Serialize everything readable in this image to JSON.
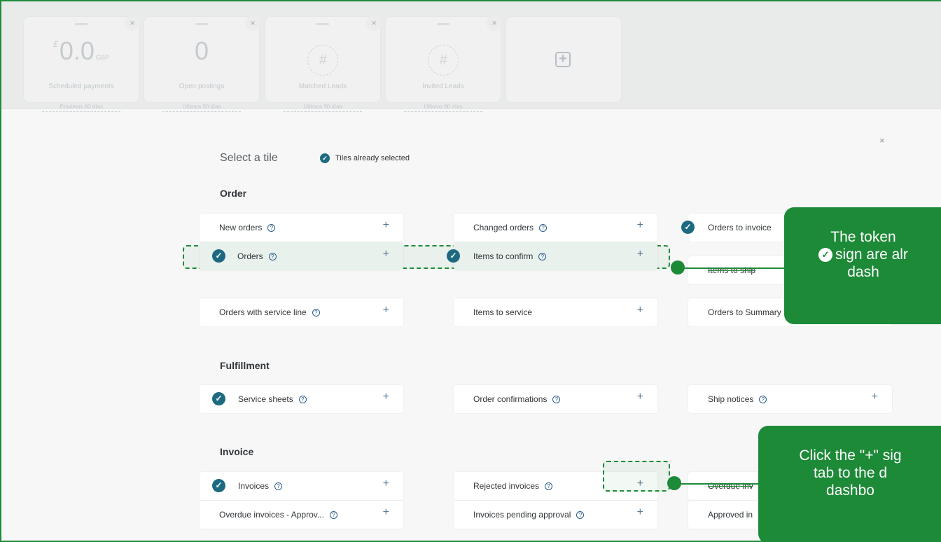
{
  "kpis": [
    {
      "currency": "£",
      "value": "0.0",
      "unit": "GBP",
      "label": "Scheduled payments",
      "period": "Próximos 90 días"
    },
    {
      "value": "0",
      "label": "Open postings",
      "period": "Últimos 90 días"
    },
    {
      "icon": "#",
      "label": "Matched Leads",
      "period": "Últimos 90 días"
    },
    {
      "icon": "#",
      "label": "Invited Leads",
      "period": "Últimos 90 días"
    }
  ],
  "kpi_close": "×",
  "add_tile_icon": "+",
  "dialog": {
    "close": "×",
    "title": "Select a tile",
    "legend": "Tiles already selected"
  },
  "check_glyph": "✓",
  "help_glyph": "?",
  "plus_glyph": "+",
  "sections": {
    "order": {
      "title": "Order",
      "tiles": [
        {
          "name": "New orders",
          "help": true,
          "selected": false
        },
        {
          "name": "Changed orders",
          "help": true,
          "selected": false
        },
        {
          "name": "Orders to invoice",
          "help": false,
          "selected": true
        },
        {
          "name": "Orders",
          "help": true,
          "selected": true
        },
        {
          "name": "Items to confirm",
          "help": true,
          "selected": true
        },
        {
          "name": "Items to ship",
          "help": false,
          "selected": true
        },
        {
          "name": "Orders with service line",
          "help": true,
          "selected": false
        },
        {
          "name": "Items to service",
          "help": false,
          "selected": false
        },
        {
          "name": "Orders to Summary",
          "help": false,
          "selected": false
        }
      ]
    },
    "fulfillment": {
      "title": "Fulfillment",
      "tiles": [
        {
          "name": "Service sheets",
          "help": true,
          "selected": true
        },
        {
          "name": "Order confirmations",
          "help": true,
          "selected": false
        },
        {
          "name": "Ship notices",
          "help": true,
          "selected": false
        }
      ]
    },
    "invoice": {
      "title": "Invoice",
      "tiles": [
        {
          "name": "Invoices",
          "help": true,
          "selected": true
        },
        {
          "name": "Rejected invoices",
          "help": true,
          "selected": false
        },
        {
          "name": "Overdue inv",
          "help": false,
          "selected": false
        },
        {
          "name": "Overdue invoices - Approv...",
          "help": true,
          "selected": false
        },
        {
          "name": "Invoices pending approval",
          "help": true,
          "selected": false
        },
        {
          "name": "Approved in",
          "help": false,
          "selected": false
        }
      ]
    }
  },
  "callouts": {
    "selected": {
      "line1": "The token",
      "line2": "sign are alr",
      "line3": "dash"
    },
    "add": {
      "line1": "Click the \"+\" sig",
      "line2": "tab to the d",
      "line3": "dashbo"
    }
  },
  "colors": {
    "accent_green": "#1d8a38",
    "check_teal": "#1d6a80",
    "frame_border": "#1e8c3a"
  }
}
